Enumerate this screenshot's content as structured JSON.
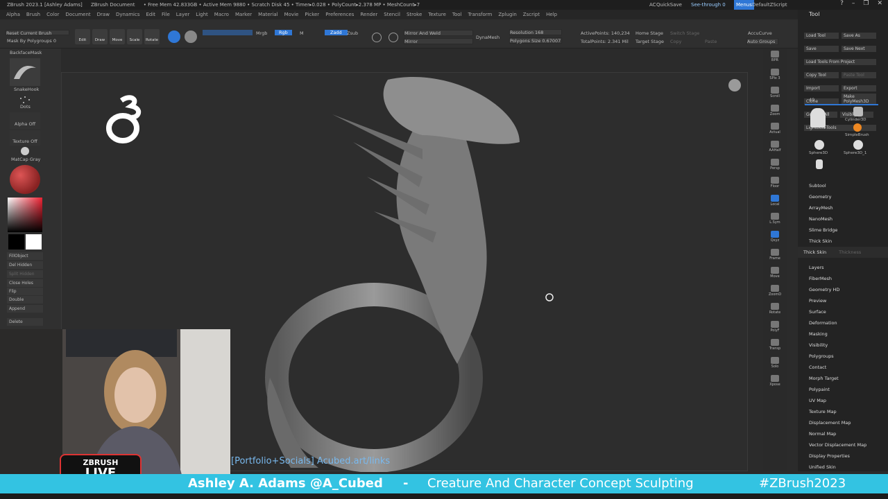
{
  "titlebar": {
    "app": "ZBrush 2023.1 [Ashley Adams]",
    "doc": "ZBrush Document",
    "stats": "• Free Mem 42.833GB • Active Mem 9880 • Scratch Disk 45 • Timer▸0.028 • PolyCount▸2.378 MP • MeshCount▸7",
    "ac": "AC",
    "quicksave": "QuickSave",
    "seethrough": "See-through 0",
    "menus": "Menus",
    "script": "DefaultZScript"
  },
  "menubar": [
    "Alpha",
    "Brush",
    "Color",
    "Document",
    "Draw",
    "Dynamics",
    "Edit",
    "File",
    "Layer",
    "Light",
    "Macro",
    "Marker",
    "Material",
    "Movie",
    "Picker",
    "Preferences",
    "Render",
    "Stencil",
    "Stroke",
    "Texture",
    "Tool",
    "Transform",
    "Zplugin",
    "Zscript",
    "Help"
  ],
  "topshelf": {
    "reset_brush": "Reset Current Brush",
    "mask_polygroups": "Mask By Polygroups 0",
    "edit": "Edit",
    "draw": "Draw",
    "move": "Move",
    "scale": "Scale",
    "rotate": "Rotate",
    "mrgb": "Mrgb",
    "rgb": "Rgb",
    "m": "M",
    "zadd": "Zadd",
    "zsub": "Zsub",
    "mirror_weld": "Mirror And Weld",
    "mirror": "Mirror",
    "dynamesh": "DynaMesh",
    "resolution": "Resolution 168",
    "polygons_size": "Polygons Size 0.67007",
    "active_points": "ActivePoints: 140,234",
    "total_points": "TotalPoints: 2.341 Mil",
    "home_stage": "Home Stage",
    "target_stage": "Target Stage",
    "switch_stage": "Switch Stage",
    "copy": "Copy",
    "paste": "Paste",
    "accucurve": "AccuCurve",
    "auto_groups": "Auto Groups"
  },
  "left": {
    "backface": "BackfaceMask",
    "brush": "SnakeHook",
    "stroke": "Dots",
    "alpha": "Alpha Off",
    "texture": "Texture Off",
    "material": "MatCap Gray",
    "fill": "FillObject",
    "del_hidden": "Del Hidden",
    "split_hidden": "Split Hidden",
    "close_holes": "Close Holes",
    "flip": "Flip",
    "double": "Double",
    "append": "Append",
    "delete": "Delete"
  },
  "rightshelf": [
    "BPR",
    "SPix 3",
    "Scroll",
    "Zoom",
    "Actual",
    "AAHalf",
    "Persp",
    "Floor",
    "Local",
    "L.Sym",
    "Qxyz",
    "Frame",
    "Move",
    "ZoomD",
    "Rotate",
    "PolyF",
    "Transp",
    "Solo",
    "Xpose"
  ],
  "toolpanel": {
    "title": "Tool",
    "buttons": [
      "Load Tool",
      "Save As",
      "Save",
      "Save Next",
      "Load Tools From Project",
      "Copy Tool",
      "Paste Tool",
      "Import",
      "Export",
      "Clone",
      "Make PolyMesh3D",
      "GoZ",
      "All",
      "Visible",
      "R",
      "Lightbox▸Tools"
    ],
    "count": "49",
    "tools": [
      "Cylinder3D",
      "SimpleBrush",
      "Sphere3D",
      "Sphere3D_1"
    ],
    "sections": [
      "Subtool",
      "Geometry",
      "ArrayMesh",
      "NanoMesh",
      "Slime Bridge",
      "Thick Skin",
      "Layers",
      "FiberMesh",
      "Geometry HD",
      "Preview",
      "Surface",
      "Deformation",
      "Masking",
      "Visibility",
      "Polygroups",
      "Contact",
      "Morph Target",
      "Polypaint",
      "UV Map",
      "Texture Map",
      "Displacement Map",
      "Normal Map",
      "Vector Displacement Map",
      "Display Properties",
      "Unified Skin",
      "Export"
    ],
    "thick_skin_sub": "Thick Skin",
    "thickness": "Thickness"
  },
  "overlay": {
    "link": "[Portfolio+Socials] Acubed.art/links",
    "logo_top": "ZBRUSH",
    "logo_bottom": "LIVE",
    "name": "Ashley A. Adams @A_Cubed",
    "dash": "-",
    "topic": "Creature And Character Concept Sculpting",
    "hashtag": "#ZBrush2023"
  }
}
